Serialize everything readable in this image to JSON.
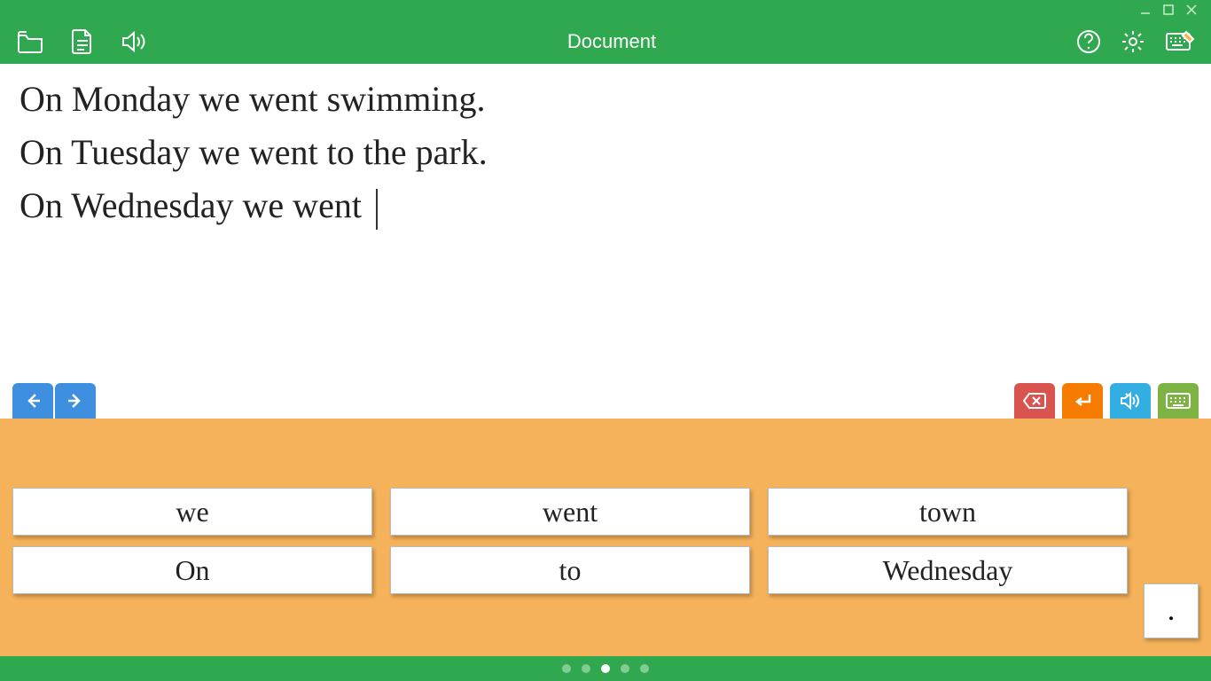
{
  "window": {
    "title": "Document"
  },
  "document": {
    "lines": [
      "On Monday we went swimming.",
      "On Tuesday we went to the park.",
      "On Wednesday we went "
    ]
  },
  "wordbank": {
    "words": [
      "we",
      "went",
      "town",
      "On",
      "to",
      "Wednesday"
    ],
    "period": "."
  },
  "pager": {
    "count": 5,
    "active_index": 2
  }
}
